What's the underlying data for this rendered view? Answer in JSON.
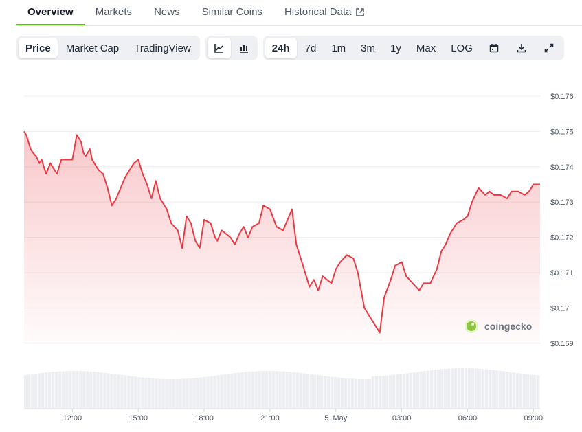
{
  "tabs": [
    {
      "label": "Overview",
      "active": true
    },
    {
      "label": "Markets",
      "active": false
    },
    {
      "label": "News",
      "active": false
    },
    {
      "label": "Similar Coins",
      "active": false
    },
    {
      "label": "Historical Data",
      "active": false,
      "icon": "external-link-icon"
    }
  ],
  "toolbar": {
    "chart_types": [
      {
        "label": "Price",
        "active": true
      },
      {
        "label": "Market Cap",
        "active": false
      },
      {
        "label": "TradingView",
        "active": false
      }
    ],
    "view_icons": [
      "line-chart-icon",
      "candlestick-chart-icon"
    ],
    "ranges": [
      {
        "label": "24h",
        "active": true
      },
      {
        "label": "7d",
        "active": false
      },
      {
        "label": "1m",
        "active": false
      },
      {
        "label": "3m",
        "active": false
      },
      {
        "label": "1y",
        "active": false
      },
      {
        "label": "Max",
        "active": false
      },
      {
        "label": "LOG",
        "active": false
      }
    ],
    "action_icons": [
      "calendar-icon",
      "download-icon",
      "fullscreen-icon"
    ]
  },
  "brand": {
    "name": "coingecko",
    "icon": "coingecko-logo-icon"
  },
  "colors": {
    "line": "#ea3943",
    "area": "#ea3943",
    "volume": "#e5e7eb",
    "tab_accent": "#4bcc00",
    "grid": "#eceef1"
  },
  "chart_data": {
    "type": "line",
    "title": "",
    "xlabel": "",
    "ylabel": "",
    "y_ticks": [
      0.169,
      0.17,
      0.171,
      0.172,
      0.173,
      0.174,
      0.175,
      0.176
    ],
    "y_tick_labels": [
      "$0.169",
      "$0.17",
      "$0.171",
      "$0.172",
      "$0.173",
      "$0.174",
      "$0.175",
      "$0.176"
    ],
    "ylim": [
      0.169,
      0.176
    ],
    "x_range_hours": [
      9.8,
      33.3
    ],
    "x_ticks": [
      {
        "hour": 12,
        "label": "12:00"
      },
      {
        "hour": 15,
        "label": "15:00"
      },
      {
        "hour": 18,
        "label": "18:00"
      },
      {
        "hour": 21,
        "label": "21:00"
      },
      {
        "hour": 24,
        "label": "5. May"
      },
      {
        "hour": 27,
        "label": "03:00"
      },
      {
        "hour": 30,
        "label": "06:00"
      },
      {
        "hour": 33,
        "label": "09:00"
      }
    ],
    "grid": true,
    "series": [
      {
        "x": [
          9.8,
          9.9,
          10.0,
          10.1,
          10.2,
          10.35,
          10.5,
          10.6,
          10.8,
          11.0,
          11.1,
          11.3,
          11.5,
          11.7,
          12.0,
          12.2,
          12.4,
          12.5,
          12.6,
          12.8,
          12.9,
          13.0,
          13.2,
          13.4,
          13.6,
          13.8,
          14.0,
          14.2,
          14.4,
          14.6,
          14.8,
          15.0,
          15.2,
          15.4,
          15.6,
          15.8,
          16.0,
          16.3,
          16.5,
          16.8,
          17.0,
          17.2,
          17.4,
          17.6,
          17.8,
          18.0,
          18.3,
          18.5,
          18.6,
          18.8,
          19.0,
          19.2,
          19.4,
          19.6,
          19.8,
          20.0,
          20.2,
          20.5,
          20.7,
          21.0,
          21.3,
          21.6,
          21.8,
          22.0,
          22.2,
          22.5,
          22.8,
          23.0,
          23.2,
          23.4,
          23.6,
          23.8,
          24.0,
          24.2,
          24.5,
          24.8,
          25.0,
          25.3,
          25.6,
          25.8,
          26.0,
          26.2,
          26.5,
          26.7,
          27.0,
          27.2,
          27.5,
          27.8,
          28.0,
          28.3,
          28.6,
          28.8,
          29.0,
          29.2,
          29.5,
          29.8,
          30.0,
          30.2,
          30.5,
          30.8,
          31.0,
          31.2,
          31.5,
          31.8,
          32.0,
          32.3,
          32.6,
          32.8,
          33.0,
          33.2,
          33.3
        ],
        "y": [
          0.175,
          0.1749,
          0.1747,
          0.1745,
          0.1744,
          0.1743,
          0.1741,
          0.1742,
          0.1738,
          0.1741,
          0.174,
          0.1738,
          0.1742,
          0.1742,
          0.1742,
          0.1749,
          0.1747,
          0.1744,
          0.1743,
          0.1745,
          0.1742,
          0.1741,
          0.1739,
          0.1738,
          0.1734,
          0.1729,
          0.1731,
          0.1734,
          0.1737,
          0.1739,
          0.1741,
          0.1742,
          0.1738,
          0.1735,
          0.1731,
          0.1736,
          0.1731,
          0.1728,
          0.1724,
          0.1722,
          0.1717,
          0.1726,
          0.1724,
          0.1719,
          0.1717,
          0.1725,
          0.1724,
          0.172,
          0.1719,
          0.1722,
          0.1721,
          0.172,
          0.1718,
          0.1721,
          0.1723,
          0.172,
          0.1723,
          0.1724,
          0.1729,
          0.1728,
          0.1723,
          0.1722,
          0.1725,
          0.1728,
          0.1718,
          0.1712,
          0.1706,
          0.1708,
          0.1705,
          0.1709,
          0.1708,
          0.1707,
          0.1711,
          0.1713,
          0.1715,
          0.1714,
          0.171,
          0.17,
          0.1697,
          0.1695,
          0.1693,
          0.1703,
          0.1708,
          0.1712,
          0.1713,
          0.1709,
          0.1707,
          0.1705,
          0.1707,
          0.1707,
          0.1711,
          0.1716,
          0.1718,
          0.1721,
          0.1724,
          0.1725,
          0.1726,
          0.173,
          0.1734,
          0.1732,
          0.1733,
          0.1732,
          0.1732,
          0.1731,
          0.1733,
          0.1733,
          0.1732,
          0.1733,
          0.1735,
          0.1735,
          0.1735
        ]
      }
    ]
  }
}
